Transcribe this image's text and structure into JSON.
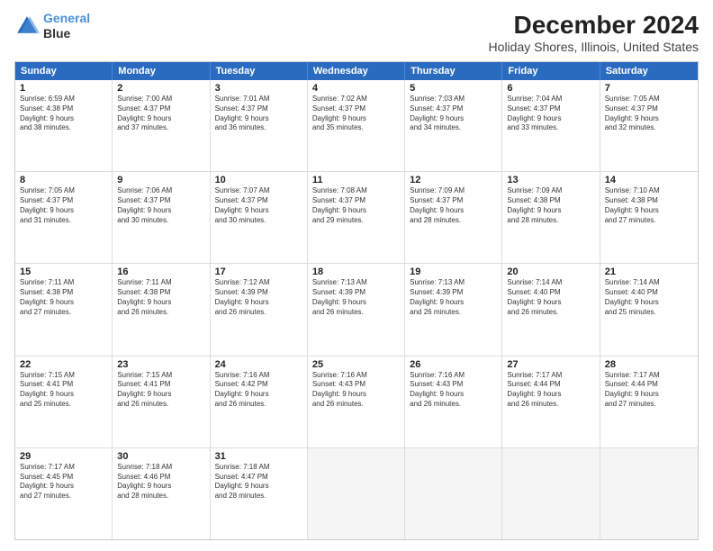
{
  "logo": {
    "line1": "General",
    "line2": "Blue"
  },
  "title": "December 2024",
  "subtitle": "Holiday Shores, Illinois, United States",
  "header_days": [
    "Sunday",
    "Monday",
    "Tuesday",
    "Wednesday",
    "Thursday",
    "Friday",
    "Saturday"
  ],
  "weeks": [
    [
      {
        "day": "1",
        "text": "Sunrise: 6:59 AM\nSunset: 4:38 PM\nDaylight: 9 hours\nand 38 minutes."
      },
      {
        "day": "2",
        "text": "Sunrise: 7:00 AM\nSunset: 4:37 PM\nDaylight: 9 hours\nand 37 minutes."
      },
      {
        "day": "3",
        "text": "Sunrise: 7:01 AM\nSunset: 4:37 PM\nDaylight: 9 hours\nand 36 minutes."
      },
      {
        "day": "4",
        "text": "Sunrise: 7:02 AM\nSunset: 4:37 PM\nDaylight: 9 hours\nand 35 minutes."
      },
      {
        "day": "5",
        "text": "Sunrise: 7:03 AM\nSunset: 4:37 PM\nDaylight: 9 hours\nand 34 minutes."
      },
      {
        "day": "6",
        "text": "Sunrise: 7:04 AM\nSunset: 4:37 PM\nDaylight: 9 hours\nand 33 minutes."
      },
      {
        "day": "7",
        "text": "Sunrise: 7:05 AM\nSunset: 4:37 PM\nDaylight: 9 hours\nand 32 minutes."
      }
    ],
    [
      {
        "day": "8",
        "text": "Sunrise: 7:05 AM\nSunset: 4:37 PM\nDaylight: 9 hours\nand 31 minutes."
      },
      {
        "day": "9",
        "text": "Sunrise: 7:06 AM\nSunset: 4:37 PM\nDaylight: 9 hours\nand 30 minutes."
      },
      {
        "day": "10",
        "text": "Sunrise: 7:07 AM\nSunset: 4:37 PM\nDaylight: 9 hours\nand 30 minutes."
      },
      {
        "day": "11",
        "text": "Sunrise: 7:08 AM\nSunset: 4:37 PM\nDaylight: 9 hours\nand 29 minutes."
      },
      {
        "day": "12",
        "text": "Sunrise: 7:09 AM\nSunset: 4:37 PM\nDaylight: 9 hours\nand 28 minutes."
      },
      {
        "day": "13",
        "text": "Sunrise: 7:09 AM\nSunset: 4:38 PM\nDaylight: 9 hours\nand 28 minutes."
      },
      {
        "day": "14",
        "text": "Sunrise: 7:10 AM\nSunset: 4:38 PM\nDaylight: 9 hours\nand 27 minutes."
      }
    ],
    [
      {
        "day": "15",
        "text": "Sunrise: 7:11 AM\nSunset: 4:38 PM\nDaylight: 9 hours\nand 27 minutes."
      },
      {
        "day": "16",
        "text": "Sunrise: 7:11 AM\nSunset: 4:38 PM\nDaylight: 9 hours\nand 26 minutes."
      },
      {
        "day": "17",
        "text": "Sunrise: 7:12 AM\nSunset: 4:39 PM\nDaylight: 9 hours\nand 26 minutes."
      },
      {
        "day": "18",
        "text": "Sunrise: 7:13 AM\nSunset: 4:39 PM\nDaylight: 9 hours\nand 26 minutes."
      },
      {
        "day": "19",
        "text": "Sunrise: 7:13 AM\nSunset: 4:39 PM\nDaylight: 9 hours\nand 26 minutes."
      },
      {
        "day": "20",
        "text": "Sunrise: 7:14 AM\nSunset: 4:40 PM\nDaylight: 9 hours\nand 26 minutes."
      },
      {
        "day": "21",
        "text": "Sunrise: 7:14 AM\nSunset: 4:40 PM\nDaylight: 9 hours\nand 25 minutes."
      }
    ],
    [
      {
        "day": "22",
        "text": "Sunrise: 7:15 AM\nSunset: 4:41 PM\nDaylight: 9 hours\nand 25 minutes."
      },
      {
        "day": "23",
        "text": "Sunrise: 7:15 AM\nSunset: 4:41 PM\nDaylight: 9 hours\nand 26 minutes."
      },
      {
        "day": "24",
        "text": "Sunrise: 7:16 AM\nSunset: 4:42 PM\nDaylight: 9 hours\nand 26 minutes."
      },
      {
        "day": "25",
        "text": "Sunrise: 7:16 AM\nSunset: 4:43 PM\nDaylight: 9 hours\nand 26 minutes."
      },
      {
        "day": "26",
        "text": "Sunrise: 7:16 AM\nSunset: 4:43 PM\nDaylight: 9 hours\nand 26 minutes."
      },
      {
        "day": "27",
        "text": "Sunrise: 7:17 AM\nSunset: 4:44 PM\nDaylight: 9 hours\nand 26 minutes."
      },
      {
        "day": "28",
        "text": "Sunrise: 7:17 AM\nSunset: 4:44 PM\nDaylight: 9 hours\nand 27 minutes."
      }
    ],
    [
      {
        "day": "29",
        "text": "Sunrise: 7:17 AM\nSunset: 4:45 PM\nDaylight: 9 hours\nand 27 minutes."
      },
      {
        "day": "30",
        "text": "Sunrise: 7:18 AM\nSunset: 4:46 PM\nDaylight: 9 hours\nand 28 minutes."
      },
      {
        "day": "31",
        "text": "Sunrise: 7:18 AM\nSunset: 4:47 PM\nDaylight: 9 hours\nand 28 minutes."
      },
      {
        "day": "",
        "text": ""
      },
      {
        "day": "",
        "text": ""
      },
      {
        "day": "",
        "text": ""
      },
      {
        "day": "",
        "text": ""
      }
    ]
  ]
}
